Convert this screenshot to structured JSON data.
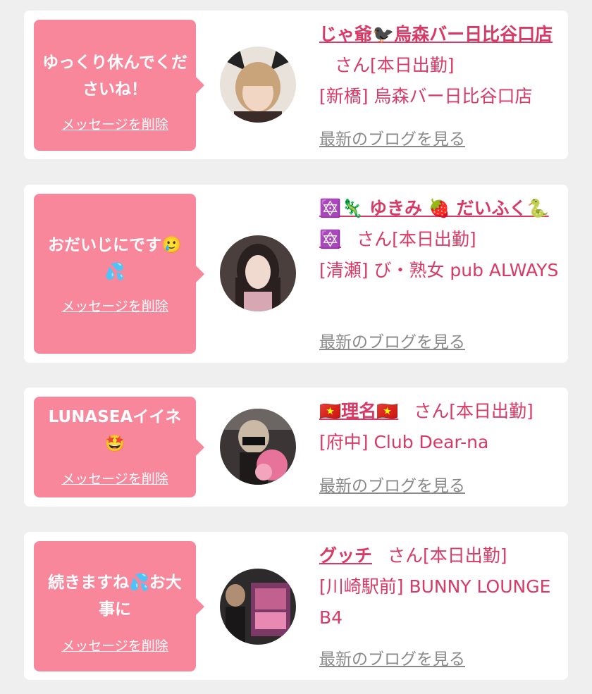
{
  "delete_label": "メッセージを削除",
  "blog_label": "最新のブログを見る",
  "san_suffix": "さん[本日出勤]",
  "colors": {
    "bubble": "#f8879c",
    "accent": "#d83a65",
    "link_gray": "#8a8a8a",
    "background": "#efefef"
  },
  "messages": [
    {
      "bubble_text": "ゆっくり休んでくださいね！",
      "name": "じゃ爺🐦‍⬛烏森バー日比谷口店",
      "shop": "[新橋] 烏森バー日比谷口店"
    },
    {
      "bubble_text": "おだいじにです🥲💦",
      "name": "🔯🦎 ゆきみ 🍓 だいふく🐍🔯",
      "shop": "[清瀬] び・熟女 pub ALWAYS"
    },
    {
      "bubble_text": "LUNASEAイイネ🤩",
      "name": "🇻🇳理名🇻🇳",
      "shop": "[府中] Club Dear-na"
    },
    {
      "bubble_text": "続きますね💦お大事に",
      "name": "グッチ",
      "shop": "[川崎駅前] BUNNY LOUNGE B4"
    }
  ]
}
